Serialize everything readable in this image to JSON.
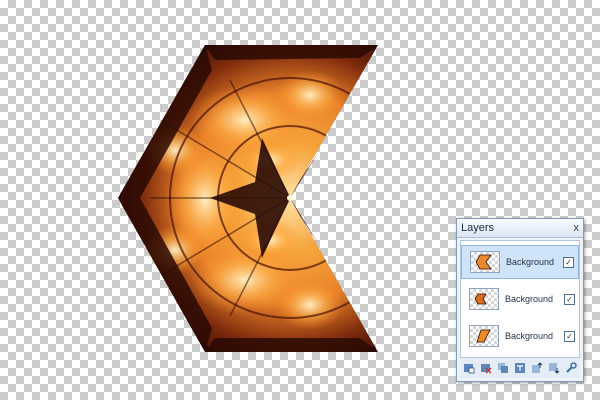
{
  "layers_panel": {
    "title": "Layers",
    "close_glyph": "x",
    "layers": [
      {
        "name": "Background",
        "visible": true,
        "selected": true
      },
      {
        "name": "Background",
        "visible": true,
        "selected": false
      },
      {
        "name": "Background",
        "visible": true,
        "selected": false
      }
    ],
    "toolbar_icons": [
      "add-layer-icon",
      "delete-layer-icon",
      "duplicate-layer-icon",
      "merge-layer-icon",
      "move-layer-up-icon",
      "move-layer-down-icon",
      "layer-properties-icon"
    ]
  },
  "colors": {
    "canvas_checker_light": "#ffffff",
    "canvas_checker_dark": "#cccccc",
    "flame_orange": "#f29b3a",
    "flame_yellow": "#ffd58a",
    "flame_dark": "#2a0905",
    "panel_bg": "#eef3fa",
    "selection_bg": "#cfe3fb"
  }
}
